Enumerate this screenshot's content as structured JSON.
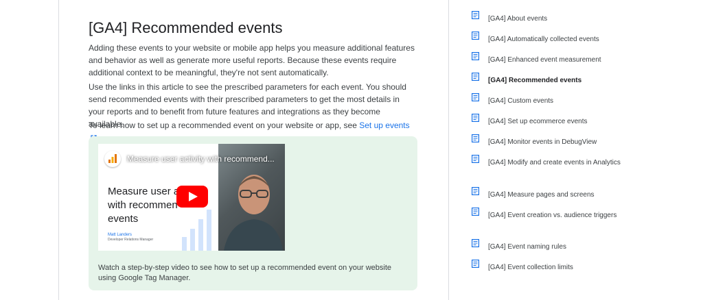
{
  "article": {
    "title": "[GA4] Recommended events",
    "intro": "Adding these events to your website or mobile app helps you measure additional features and behavior as well as generate more useful reports. Because these events require additional context to be meaningful, they're not sent automatically.",
    "links_paragraph": "Use the links in this article to see the prescribed parameters for each event. You should send recommended events with their prescribed parameters to get the most details in your reports and to benefit from future features and integrations as they become available.",
    "setup_prefix": "To learn how to set up a recommended event on your website or app, see",
    "setup_link": "Set up events",
    "setup_suffix": "."
  },
  "video": {
    "title": "Measure user activity with recommend...",
    "slide_heading": "Measure user ac\nwith recommen\nevents",
    "presenter_name": "Matt Landers",
    "presenter_role": "Developer Relations Manager",
    "caption": "Watch a step-by-step video to see how to set up a recommended event on your website using Google Tag Manager."
  },
  "toc": {
    "icon": "document-icon",
    "items": [
      {
        "label": "[GA4] About events",
        "active": false
      },
      {
        "label": "[GA4] Automatically collected events",
        "active": false
      },
      {
        "label": "[GA4] Enhanced event measurement",
        "active": false
      },
      {
        "label": "[GA4] Recommended events",
        "active": true
      },
      {
        "label": "[GA4] Custom events",
        "active": false
      },
      {
        "label": "[GA4] Set up ecommerce events",
        "active": false
      },
      {
        "label": "[GA4] Monitor events in DebugView",
        "active": false
      },
      {
        "label": "[GA4] Modify and create events in Analytics",
        "active": false
      },
      {
        "label": "[GA4] Measure pages and screens",
        "active": false
      },
      {
        "label": "[GA4] Event creation vs. audience triggers",
        "active": false
      },
      {
        "label": "[GA4] Event naming rules",
        "active": false
      },
      {
        "label": "[GA4] Event collection limits",
        "active": false
      }
    ]
  },
  "colors": {
    "link": "#1a73e8",
    "callout_bg": "#e6f4ea",
    "toc_icon": "#1a73e8",
    "youtube_red": "#ff0000"
  }
}
